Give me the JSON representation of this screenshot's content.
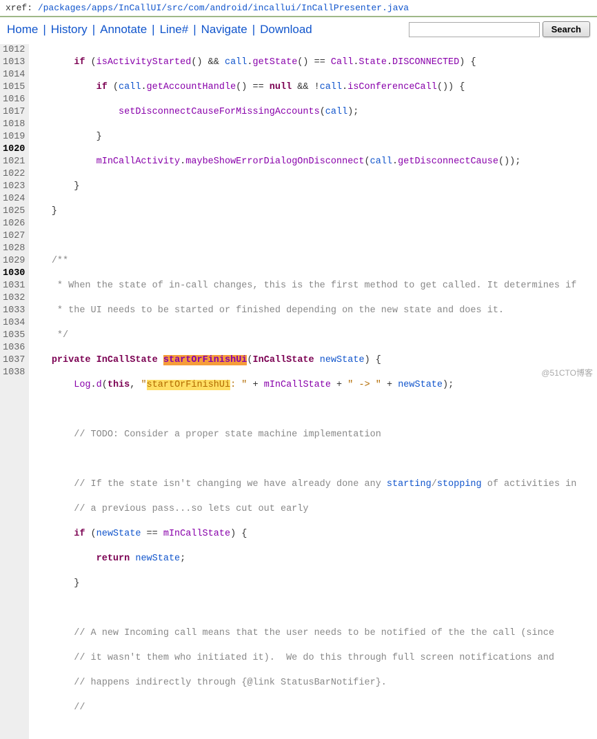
{
  "xref": {
    "label": "xref:",
    "path": " /packages/apps/InCallUI/src/com/android/incallui/InCallPresenter.java"
  },
  "nav": {
    "items": [
      "Home",
      "History",
      "Annotate",
      "Line#",
      "Navigate",
      "Download"
    ]
  },
  "search": {
    "placeholder": "",
    "value": "",
    "button": "Search"
  },
  "lines": {
    "start": 1012,
    "end": 1038,
    "highlighted": [
      1020,
      1030
    ]
  },
  "tokens": {
    "if": "if",
    "private": "private",
    "this": "this",
    "return": "return",
    "null": "null",
    "isActivityStarted": "isActivityStarted",
    "getState": "getState",
    "State": "State",
    "DISCONNECTED": "DISCONNECTED",
    "call": "call",
    "Call": "Call",
    "getAccountHandle": "getAccountHandle",
    "isConferenceCall": "isConferenceCall",
    "setDisconnectCauseForMissingAccounts": "setDisconnectCauseForMissingAccounts",
    "mInCallActivity": "mInCallActivity",
    "maybeShowErrorDialogOnDisconnect": "maybeShowErrorDialogOnDisconnect",
    "getDisconnectCause": "getDisconnectCause",
    "InCallState": "InCallState",
    "startOrFinishUi": "startOrFinishUi",
    "newState": "newState",
    "Log": "Log",
    "d": "d",
    "mInCallState": "mInCallState",
    "starting": "starting",
    "stopping": "stopping"
  },
  "strings": {
    "sof_prefix": "\"",
    "sof_body": "startOrFinishUi",
    "sof_suffix": ": \"",
    "arrow": "\" -> \""
  },
  "comments": {
    "doc_open": "/**",
    "doc_l1": " * When the state of in-call changes, this is the first method to get called. It determines if",
    "doc_l2": " * the UI needs to be started or finished depending on the new state and does it.",
    "doc_close": " */",
    "todo": "// TODO: Consider a proper state machine implementation",
    "c1a": "// If the state isn't changing we have already done any ",
    "c1b": " of activities in",
    "c2": "// a previous pass...so lets cut out early",
    "c3": "// A new Incoming call means that the user needs to be notified of the the call (since",
    "c4": "// it wasn't them who initiated it).  We do this through full screen notifications and",
    "c5": "// happens indirectly through {@link StatusBarNotifier}.",
    "c6": "//"
  },
  "watermark": "@51CTO博客"
}
